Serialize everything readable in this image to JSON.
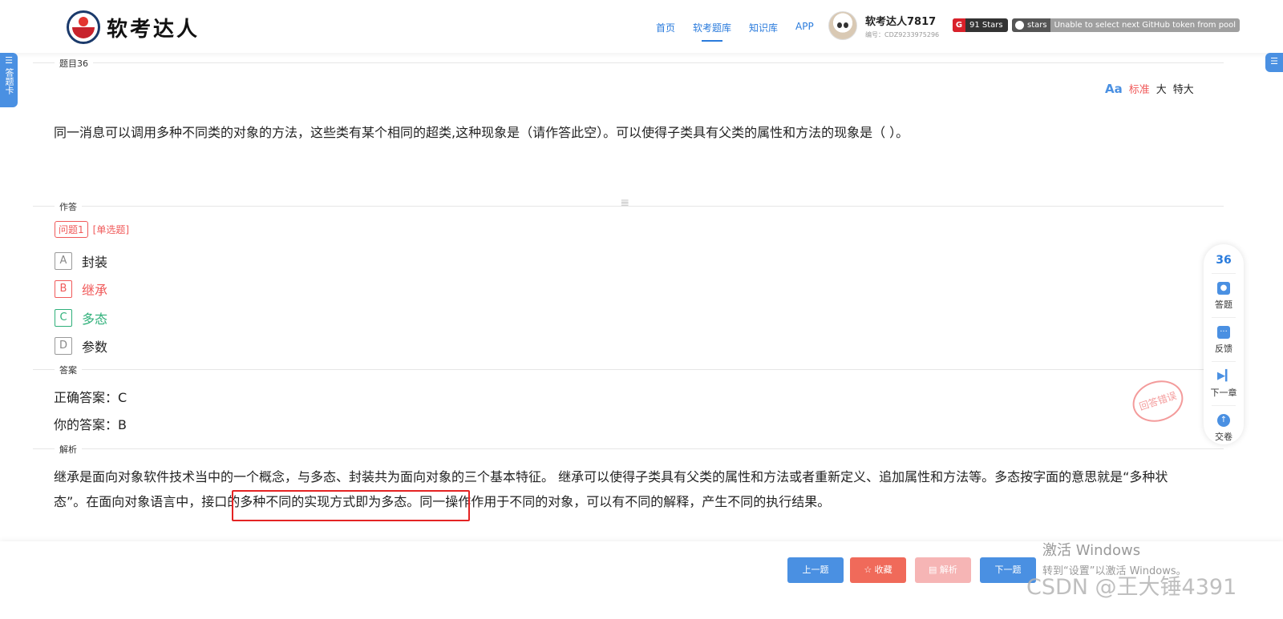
{
  "header": {
    "logo_text": "软考达人",
    "nav": [
      "首页",
      "软考题库",
      "知识库",
      "APP"
    ],
    "user_name": "软考达人7817",
    "user_id": "编号：CDZ9233975296",
    "stars_badge": "91 Stars",
    "gh_left": "stars",
    "gh_right": "Unable to select next GitHub token from pool"
  },
  "side": {
    "left_tab_label": "答题卡"
  },
  "sections": {
    "question": "题目36",
    "answer_area": "作答",
    "answer": "答案",
    "analysis": "解析"
  },
  "font_size": {
    "options": [
      "标准",
      "大",
      "特大"
    ],
    "active": "标准"
  },
  "question_text": "同一消息可以调用多种不同类的对象的方法，这些类有某个相同的超类,这种现象是（请作答此空）。可以使得子类具有父类的属性和方法的现象是（ ）。",
  "question_tag": {
    "number": "问题1",
    "type": "[单选题]"
  },
  "options": [
    {
      "key": "A",
      "label": "封装",
      "state": "normal"
    },
    {
      "key": "B",
      "label": "继承",
      "state": "wrong"
    },
    {
      "key": "C",
      "label": "多态",
      "state": "right"
    },
    {
      "key": "D",
      "label": "参数",
      "state": "normal"
    }
  ],
  "answer": {
    "correct": "正确答案：C",
    "yours": "你的答案：B",
    "stamp": "回答错误"
  },
  "analysis_text": "继承是面向对象软件技术当中的一个概念，与多态、封装共为面向对象的三个基本特征。 继承可以使得子类具有父类的属性和方法或者重新定义、追加属性和方法等。多态按字面的意思就是“多种状态”。在面向对象语言中，接口的多种不同的实现方式即为多态。同一操作作用于不同的对象，可以有不同的解释，产生不同的执行结果。",
  "tools": {
    "count": "36",
    "answer": "答题",
    "feedback": "反馈",
    "next_chapter": "下一章",
    "submit": "交卷"
  },
  "bottom": {
    "prev": "上一题",
    "fav": "☆ 收藏",
    "analysis": "▤ 解析",
    "next": "下一题"
  },
  "watermark": {
    "line1": "激活 Windows",
    "line2": "转到“设置”以激活 Windows。",
    "csdn": "CSDN @王大锤4391"
  },
  "colors": {
    "primary": "#4a90e2",
    "wrong": "#f05a5a",
    "right": "#2fb07a",
    "highlight_box": "#e42323"
  }
}
